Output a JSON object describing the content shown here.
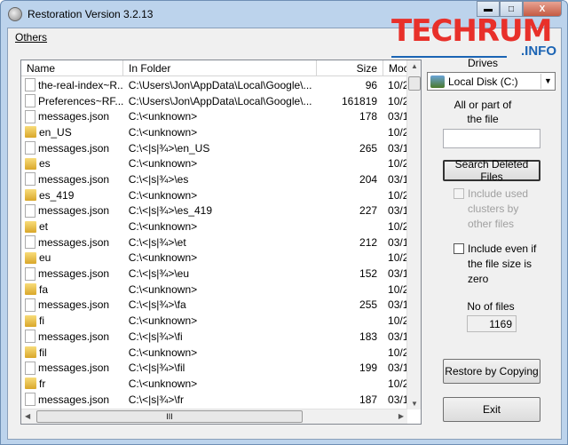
{
  "window": {
    "title": "Restoration Version 3.2.13",
    "minimize": "▬",
    "maximize": "□",
    "close": "X"
  },
  "menu": {
    "others": "Others"
  },
  "logo": {
    "main": "TECHRUM",
    "sub": ".INFO"
  },
  "list": {
    "columns": [
      "Name",
      "In Folder",
      "Size",
      "Moc"
    ],
    "rows": [
      {
        "type": "file",
        "name": "the-real-index~R...",
        "folder": "C:\\Users\\Jon\\AppData\\Local\\Google\\...",
        "size": "96",
        "mod": "10/2"
      },
      {
        "type": "file",
        "name": "Preferences~RF...",
        "folder": "C:\\Users\\Jon\\AppData\\Local\\Google\\...",
        "size": "161819",
        "mod": "10/2"
      },
      {
        "type": "file",
        "name": "messages.json",
        "folder": "C:\\<unknown>",
        "size": "178",
        "mod": "03/1"
      },
      {
        "type": "folder",
        "name": "en_US",
        "folder": "C:\\<unknown>",
        "size": "",
        "mod": "10/2"
      },
      {
        "type": "file",
        "name": "messages.json",
        "folder": "C:\\<|s|¾>\\en_US",
        "size": "265",
        "mod": "03/1"
      },
      {
        "type": "folder",
        "name": "es",
        "folder": "C:\\<unknown>",
        "size": "",
        "mod": "10/2"
      },
      {
        "type": "file",
        "name": "messages.json",
        "folder": "C:\\<|s|¾>\\es",
        "size": "204",
        "mod": "03/1"
      },
      {
        "type": "folder",
        "name": "es_419",
        "folder": "C:\\<unknown>",
        "size": "",
        "mod": "10/2"
      },
      {
        "type": "file",
        "name": "messages.json",
        "folder": "C:\\<|s|¾>\\es_419",
        "size": "227",
        "mod": "03/1"
      },
      {
        "type": "folder",
        "name": "et",
        "folder": "C:\\<unknown>",
        "size": "",
        "mod": "10/2"
      },
      {
        "type": "file",
        "name": "messages.json",
        "folder": "C:\\<|s|¾>\\et",
        "size": "212",
        "mod": "03/1"
      },
      {
        "type": "folder",
        "name": "eu",
        "folder": "C:\\<unknown>",
        "size": "",
        "mod": "10/2"
      },
      {
        "type": "file",
        "name": "messages.json",
        "folder": "C:\\<|s|¾>\\eu",
        "size": "152",
        "mod": "03/1"
      },
      {
        "type": "folder",
        "name": "fa",
        "folder": "C:\\<unknown>",
        "size": "",
        "mod": "10/2"
      },
      {
        "type": "file",
        "name": "messages.json",
        "folder": "C:\\<|s|¾>\\fa",
        "size": "255",
        "mod": "03/1"
      },
      {
        "type": "folder",
        "name": "fi",
        "folder": "C:\\<unknown>",
        "size": "",
        "mod": "10/2"
      },
      {
        "type": "file",
        "name": "messages.json",
        "folder": "C:\\<|s|¾>\\fi",
        "size": "183",
        "mod": "03/1"
      },
      {
        "type": "folder",
        "name": "fil",
        "folder": "C:\\<unknown>",
        "size": "",
        "mod": "10/2"
      },
      {
        "type": "file",
        "name": "messages.json",
        "folder": "C:\\<|s|¾>\\fil",
        "size": "199",
        "mod": "03/1"
      },
      {
        "type": "folder",
        "name": "fr",
        "folder": "C:\\<unknown>",
        "size": "",
        "mod": "10/2"
      },
      {
        "type": "file",
        "name": "messages.json",
        "folder": "C:\\<|s|¾>\\fr",
        "size": "187",
        "mod": "03/1"
      }
    ],
    "hscroll_grip": "III"
  },
  "panel": {
    "drives_label": "Drives",
    "drive_value": "Local Disk (C:)",
    "filename_label_1": "All or part of",
    "filename_label_2": "the file",
    "filename_value": "",
    "search_button": "Search Deleted Files",
    "include_used": "Include used clusters by other files",
    "include_used_checked": false,
    "include_used_disabled": true,
    "include_even": "Include even if the file size is zero",
    "include_even_checked": false,
    "no_files_label": "No of files",
    "no_files_value": "1169",
    "restore_button": "Restore by Copying",
    "exit_button": "Exit"
  }
}
